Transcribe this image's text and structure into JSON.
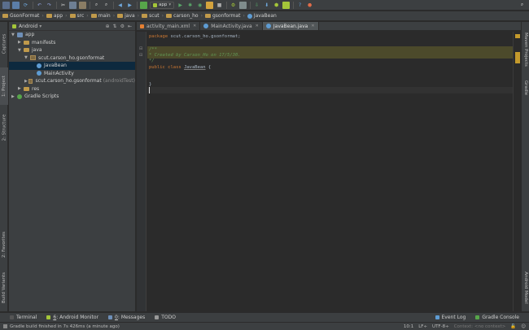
{
  "breadcrumbs": [
    "GsonFormat",
    "app",
    "src",
    "main",
    "java",
    "scut",
    "carson_ho",
    "gsonformat",
    "JavaBean"
  ],
  "toolbar": {
    "run_config": "app"
  },
  "left_strip": {
    "captures": "Captures",
    "project": "1: Project",
    "structure": "2: Structure",
    "favorites": "2: Favorites",
    "build_variants": "Build Variants"
  },
  "right_strip": {
    "maven": "Maven Projects",
    "gradle": "Gradle",
    "android_model": "Android Model"
  },
  "project_panel": {
    "view": "Android",
    "tree": {
      "app": "app",
      "manifests": "manifests",
      "java": "java",
      "pkg_main": "scut.carson_ho.gsonformat",
      "javabean": "JavaBean",
      "mainactivity": "MainActivity",
      "pkg_test": "scut.carson_ho.gsonformat",
      "pkg_test_tag": "(androidTest)",
      "res": "res",
      "gradle_scripts": "Gradle Scripts"
    }
  },
  "editor": {
    "tabs": [
      {
        "label": "activity_main.xml"
      },
      {
        "label": "MainActivity.java"
      },
      {
        "label": "JavaBean.java"
      }
    ],
    "code": {
      "pkg_kw": "package",
      "pkg_name": " scut.carson_ho.gsonformat;",
      "doc_open": "/**",
      "doc_body": " * Created by Carson_Ho on 17/5/30.",
      "doc_close": " */",
      "public_kw": "public class",
      "class_name": "JavaBean",
      "brace_open": " {",
      "brace_close": "}"
    }
  },
  "bottom_tabs": {
    "terminal": "Terminal",
    "android_monitor": "Android Monitor",
    "android_monitor_num": "6",
    "messages": "Messages",
    "messages_num": "0",
    "todo": "TODO",
    "event_log": "Event Log",
    "gradle_console": "Gradle Console"
  },
  "status": {
    "message": "Gradle build finished in 7s 426ms (a minute ago)",
    "position": "10:1",
    "line_sep": "LF÷",
    "encoding": "UTF-8÷",
    "context": "Context: <no context>"
  }
}
